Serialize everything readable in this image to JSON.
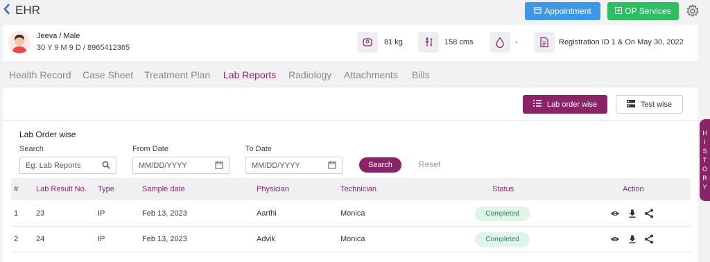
{
  "app": {
    "title": "EHR"
  },
  "header": {
    "appointment_label": "Appointment",
    "op_services_label": "OP Services"
  },
  "patient": {
    "name": "Jeeva / Male",
    "details": "30 Y 9 M 9 D / 8965412365",
    "weight": "81 kg",
    "height": "158 cms",
    "blood_group": "-",
    "registration": "Registration ID 1 & On May 30, 2022"
  },
  "tabs": [
    "Health Record",
    "Case Sheet",
    "Treatment Plan",
    "Lab Reports",
    "Radiology",
    "Attachments",
    "Bills"
  ],
  "active_tab": "Lab Reports",
  "view_toggle": {
    "lab_order_label": "Lab order wise",
    "test_label": "Test wise"
  },
  "filters": {
    "section_title": "Lab Order wise",
    "search_label": "Search",
    "search_placeholder": "Eg: Lab Reports",
    "from_label": "From Date",
    "from_placeholder": "MM/DD/YYYY",
    "to_label": "To Date",
    "to_placeholder": "MM/DD/YYYY",
    "search_button": "Search",
    "reset_button": "Reset"
  },
  "table": {
    "columns": [
      "#",
      "Lab Result No.",
      "Type",
      "Sample date",
      "Physician",
      "Technician",
      "Status",
      "Action"
    ],
    "rows": [
      {
        "index": "1",
        "result_no": "23",
        "type": "IP",
        "date": "Feb 13, 2023",
        "physician": "Aarthi",
        "technician": "Monica",
        "status": "Completed"
      },
      {
        "index": "2",
        "result_no": "24",
        "type": "IP",
        "date": "Feb 13, 2023",
        "physician": "Advik",
        "technician": "Monica",
        "status": "Completed"
      }
    ]
  },
  "history_tab": "HISTORY",
  "colors": {
    "primary": "#8a2466",
    "appointment": "#3d97e4",
    "op_services": "#2dbd62",
    "status_bg": "#dff5ea"
  },
  "icons": [
    "back-arrow-icon",
    "calendar-icon",
    "plus-icon",
    "gear-icon",
    "scale-icon",
    "height-icon",
    "blood-drop-icon",
    "document-icon",
    "list-icon",
    "grid-icon",
    "search-icon",
    "eye-icon",
    "download-icon",
    "share-icon"
  ]
}
